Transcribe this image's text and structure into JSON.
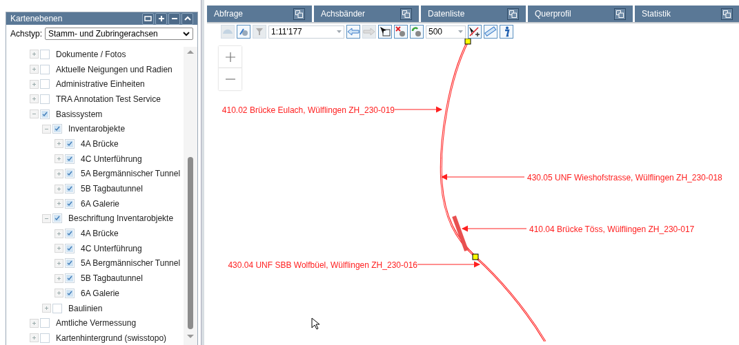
{
  "layer_panel": {
    "title": "Kartenebenen",
    "axis_type": {
      "label": "Achstyp:",
      "value": "Stamm- und Zubringerachsen"
    },
    "tree": [
      {
        "label": "Dokumente / Fotos",
        "expanded": false,
        "checked": false
      },
      {
        "label": "Aktuelle Neigungen und Radien",
        "expanded": false,
        "checked": false
      },
      {
        "label": "Administrative Einheiten",
        "expanded": false,
        "checked": false
      },
      {
        "label": "TRA Annotation Test Service",
        "expanded": false,
        "checked": false
      },
      {
        "label": "Basissystem",
        "expanded": true,
        "checked": true,
        "children": [
          {
            "label": "Inventarobjekte",
            "expanded": true,
            "checked": true,
            "children": [
              {
                "label": "4A Brücke",
                "expanded": false,
                "checked": true
              },
              {
                "label": "4C Unterführung",
                "expanded": false,
                "checked": true
              },
              {
                "label": "5A Bergmännischer Tunnel",
                "expanded": false,
                "checked": true
              },
              {
                "label": "5B Tagbautunnel",
                "expanded": false,
                "checked": true
              },
              {
                "label": "6A Galerie",
                "expanded": false,
                "checked": true
              }
            ]
          },
          {
            "label": "Beschriftung Inventarobjekte",
            "expanded": true,
            "checked": true,
            "children": [
              {
                "label": "4A Brücke",
                "expanded": false,
                "checked": true
              },
              {
                "label": "4C Unterführung",
                "expanded": false,
                "checked": true
              },
              {
                "label": "5A Bergmännischer Tunnel",
                "expanded": false,
                "checked": true
              },
              {
                "label": "5B Tagbautunnel",
                "expanded": false,
                "checked": true
              },
              {
                "label": "6A Galerie",
                "expanded": false,
                "checked": true
              }
            ]
          },
          {
            "label": "Baulinien",
            "expanded": false,
            "checked": false
          }
        ]
      },
      {
        "label": "Amtliche Vermessung",
        "expanded": false,
        "checked": false
      },
      {
        "label": "Kartenhintergrund (swisstopo)",
        "expanded": false,
        "checked": false
      }
    ]
  },
  "tabs": [
    {
      "title": "Abfrage"
    },
    {
      "title": "Achsbänder"
    },
    {
      "title": "Datenliste"
    },
    {
      "title": "Querprofil"
    },
    {
      "title": "Statistik"
    }
  ],
  "toolbar": [
    {
      "kind": "icon",
      "disabled": true
    },
    {
      "kind": "icon",
      "disabled": false
    },
    {
      "kind": "icon",
      "disabled": true
    },
    {
      "kind": "combo",
      "value": "1:11'177"
    },
    {
      "kind": "icon",
      "disabled": false
    },
    {
      "kind": "icon",
      "disabled": true
    },
    {
      "kind": "icon",
      "disabled": false
    },
    {
      "kind": "icon",
      "disabled": false
    },
    {
      "kind": "icon",
      "disabled": false
    },
    {
      "kind": "combo",
      "value": "500"
    },
    {
      "kind": "icon",
      "disabled": false
    },
    {
      "kind": "icon",
      "disabled": false
    },
    {
      "kind": "icon",
      "disabled": false
    }
  ],
  "map": {
    "labels": [
      {
        "text": "410.02 Brücke Eulach, Wülflingen ZH_230-019"
      },
      {
        "text": "430.05 UNF Wieshofstrasse, Wülflingen ZH_230-018"
      },
      {
        "text": "410.04 Brücke Töss, Wülflingen ZH_230-017"
      },
      {
        "text": "430.04 UNF SBB Wolfbüel, Wülflingen ZH_230-016"
      }
    ]
  }
}
